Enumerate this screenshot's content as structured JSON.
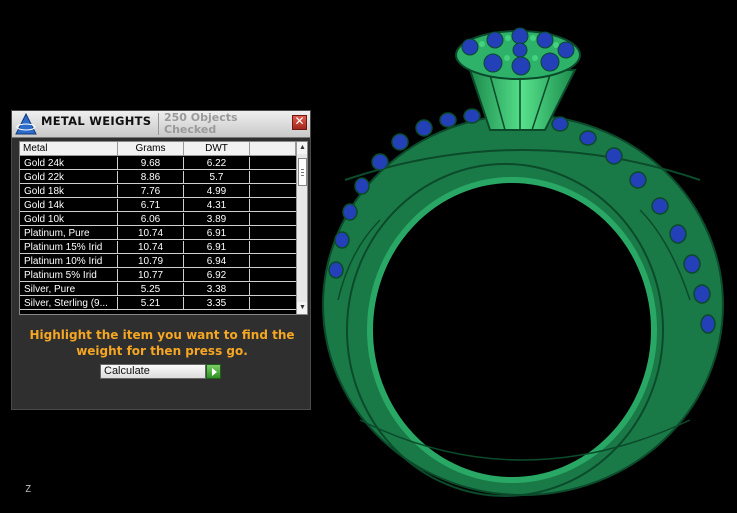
{
  "panel": {
    "title": "METAL WEIGHTS",
    "objects_checked": "250 Objects Checked",
    "close_glyph": "✕",
    "columns": [
      "Metal",
      "Grams",
      "DWT"
    ],
    "rows": [
      {
        "metal": "Gold 24k",
        "grams": "9.68",
        "dwt": "6.22"
      },
      {
        "metal": "Gold 22k",
        "grams": "8.86",
        "dwt": "5.7"
      },
      {
        "metal": "Gold 18k",
        "grams": "7.76",
        "dwt": "4.99"
      },
      {
        "metal": "Gold 14k",
        "grams": "6.71",
        "dwt": "4.31"
      },
      {
        "metal": "Gold 10k",
        "grams": "6.06",
        "dwt": "3.89"
      },
      {
        "metal": "Platinum, Pure",
        "grams": "10.74",
        "dwt": "6.91"
      },
      {
        "metal": "Platinum 15% Irid",
        "grams": "10.74",
        "dwt": "6.91"
      },
      {
        "metal": "Platinum 10% Irid",
        "grams": "10.79",
        "dwt": "6.94"
      },
      {
        "metal": "Platinum 5% Irid",
        "grams": "10.77",
        "dwt": "6.92"
      },
      {
        "metal": "Silver, Pure",
        "grams": "5.25",
        "dwt": "3.38"
      },
      {
        "metal": "Silver, Sterling (9...",
        "grams": "5.21",
        "dwt": "3.35"
      }
    ],
    "instruction": "Highlight the item you want to find the weight for then press go.",
    "calc_select_value": "Calculate"
  },
  "viewport": {
    "axis_label": "Z"
  },
  "colors": {
    "ring_green": "#1f8c52",
    "gem_blue": "#2340b8",
    "instruction_orange": "#f5a623",
    "go_green": "#3fa330"
  },
  "icons": [
    "app-logo-icon",
    "close-icon",
    "go-arrow-icon",
    "scroll-up-icon",
    "scroll-down-icon"
  ]
}
